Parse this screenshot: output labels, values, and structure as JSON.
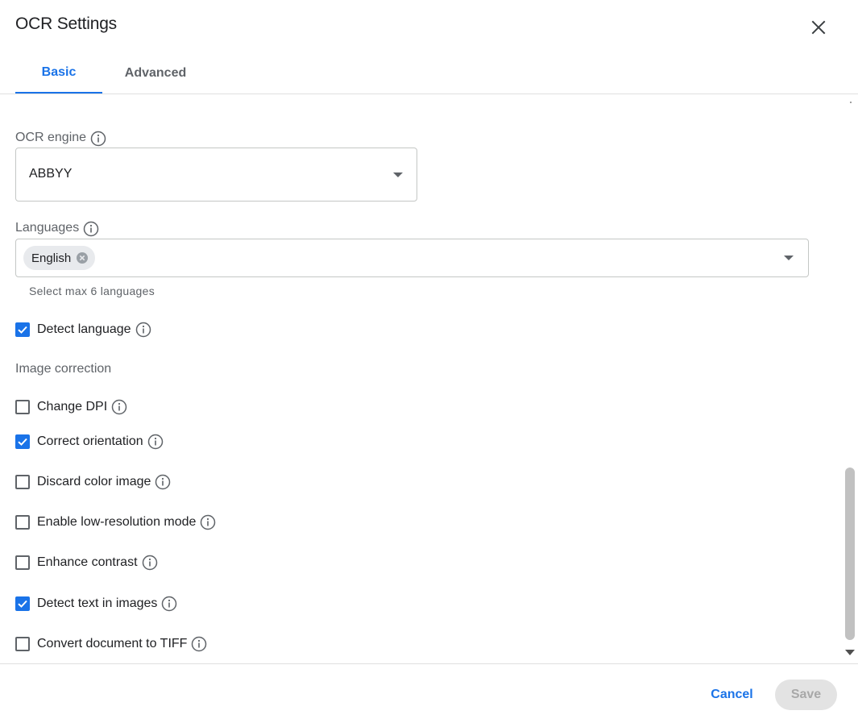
{
  "dialog": {
    "title": "OCR Settings",
    "close_icon": "close-icon"
  },
  "tabs": [
    {
      "label": "Basic",
      "active": true
    },
    {
      "label": "Advanced",
      "active": false
    }
  ],
  "ocr_engine": {
    "label": "OCR engine",
    "value": "ABBYY"
  },
  "languages": {
    "label": "Languages",
    "selected": [
      "English"
    ],
    "hint": "Select max 6 languages"
  },
  "detect_language": {
    "label": "Detect language",
    "checked": true
  },
  "image_correction": {
    "label": "Image correction",
    "options": [
      {
        "label": "Change DPI",
        "checked": false
      },
      {
        "label": "Correct orientation",
        "checked": true
      },
      {
        "label": "Discard color image",
        "checked": false
      },
      {
        "label": "Enable low-resolution mode",
        "checked": false
      },
      {
        "label": "Enhance contrast",
        "checked": false
      },
      {
        "label": "Detect text in images",
        "checked": true
      },
      {
        "label": "Convert document to TIFF",
        "checked": false
      }
    ]
  },
  "footer": {
    "cancel_label": "Cancel",
    "save_label": "Save",
    "save_enabled": false
  },
  "colors": {
    "accent": "#1a73e8",
    "text": "#202124",
    "secondary_text": "#5f6368"
  }
}
